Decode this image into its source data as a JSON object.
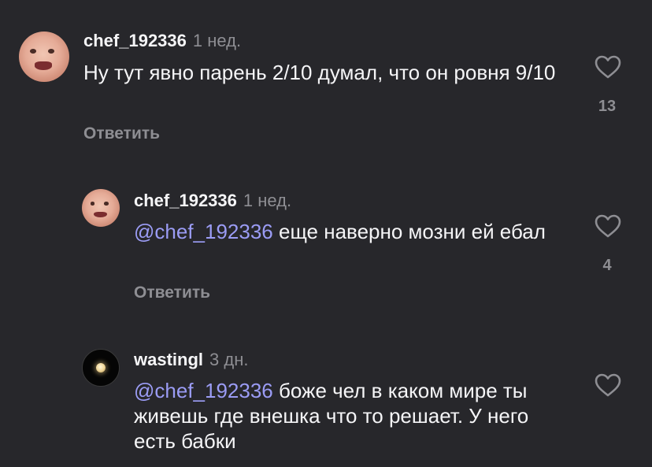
{
  "comments": [
    {
      "username": "chef_192336",
      "time": "1 нед.",
      "text": "Ну тут явно парень 2/10 думал, что он ровня 9/10",
      "mention": "",
      "reply_label": "Ответить",
      "likes": "13",
      "avatar": "face-photo"
    },
    {
      "username": "chef_192336",
      "time": "1 нед.",
      "mention": "@chef_192336",
      "text": " еще наверно мозни ей ебал",
      "reply_label": "Ответить",
      "likes": "4",
      "avatar": "face-photo"
    },
    {
      "username": "wastingl",
      "time": "3 дн.",
      "mention": "@chef_192336",
      "text": " боже чел в каком мире ты живешь где внешка что то решает. У него есть бабки",
      "reply_label": "",
      "likes": "",
      "avatar": "moon-photo"
    }
  ],
  "icons": {
    "like": "heart-outline-icon"
  },
  "colors": {
    "background": "#27272b",
    "text": "#f5f5f7",
    "muted": "#8e8e93",
    "mention": "#9b9cf5"
  }
}
